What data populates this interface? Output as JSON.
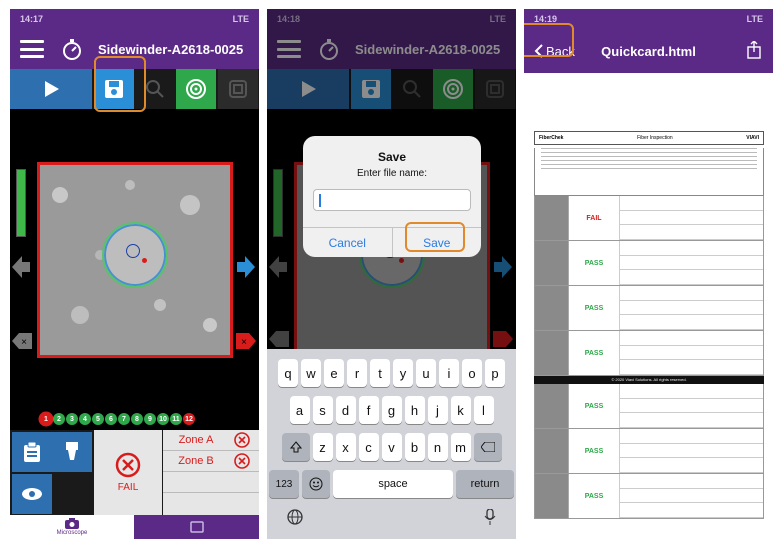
{
  "screens": [
    {
      "status_time": "14:17",
      "status_signal": "LTE",
      "title": "Sidewinder-A2618-0025",
      "fiber_numbers": [
        "1",
        "2",
        "3",
        "4",
        "5",
        "6",
        "7",
        "8",
        "9",
        "10",
        "11",
        "12"
      ],
      "result": "FAIL",
      "zones": [
        "Zone A",
        "Zone B"
      ],
      "tab_microscope": "Microscope"
    },
    {
      "status_time": "14:18",
      "status_signal": "LTE",
      "title": "Sidewinder-A2618-0025",
      "dialog": {
        "title": "Save",
        "message": "Enter file name:",
        "input_value": "",
        "cancel": "Cancel",
        "save": "Save"
      },
      "keyboard": {
        "row1": [
          "q",
          "w",
          "e",
          "r",
          "t",
          "y",
          "u",
          "i",
          "o",
          "p"
        ],
        "row2": [
          "a",
          "s",
          "d",
          "f",
          "g",
          "h",
          "j",
          "k",
          "l"
        ],
        "row3": [
          "z",
          "x",
          "c",
          "v",
          "b",
          "n",
          "m"
        ],
        "numbers_key": "123",
        "space_key": "space",
        "return_key": "return"
      }
    },
    {
      "status_time": "14:19",
      "status_signal": "LTE",
      "back_label": "Back",
      "title": "Quickcard.html",
      "doc": {
        "brand": "FiberChek",
        "heading": "Fiber Inspection",
        "logo": "VIAVI",
        "results": [
          "FAIL",
          "PASS",
          "PASS",
          "PASS",
          "PASS",
          "PASS",
          "PASS"
        ],
        "footer": "© 2020 Viavi Solutions. All rights reserved."
      }
    }
  ],
  "colors": {
    "nav": "#5b2a86",
    "highlight": "#e08a2c",
    "fail": "#d81c1c",
    "pass": "#2ea84a"
  }
}
